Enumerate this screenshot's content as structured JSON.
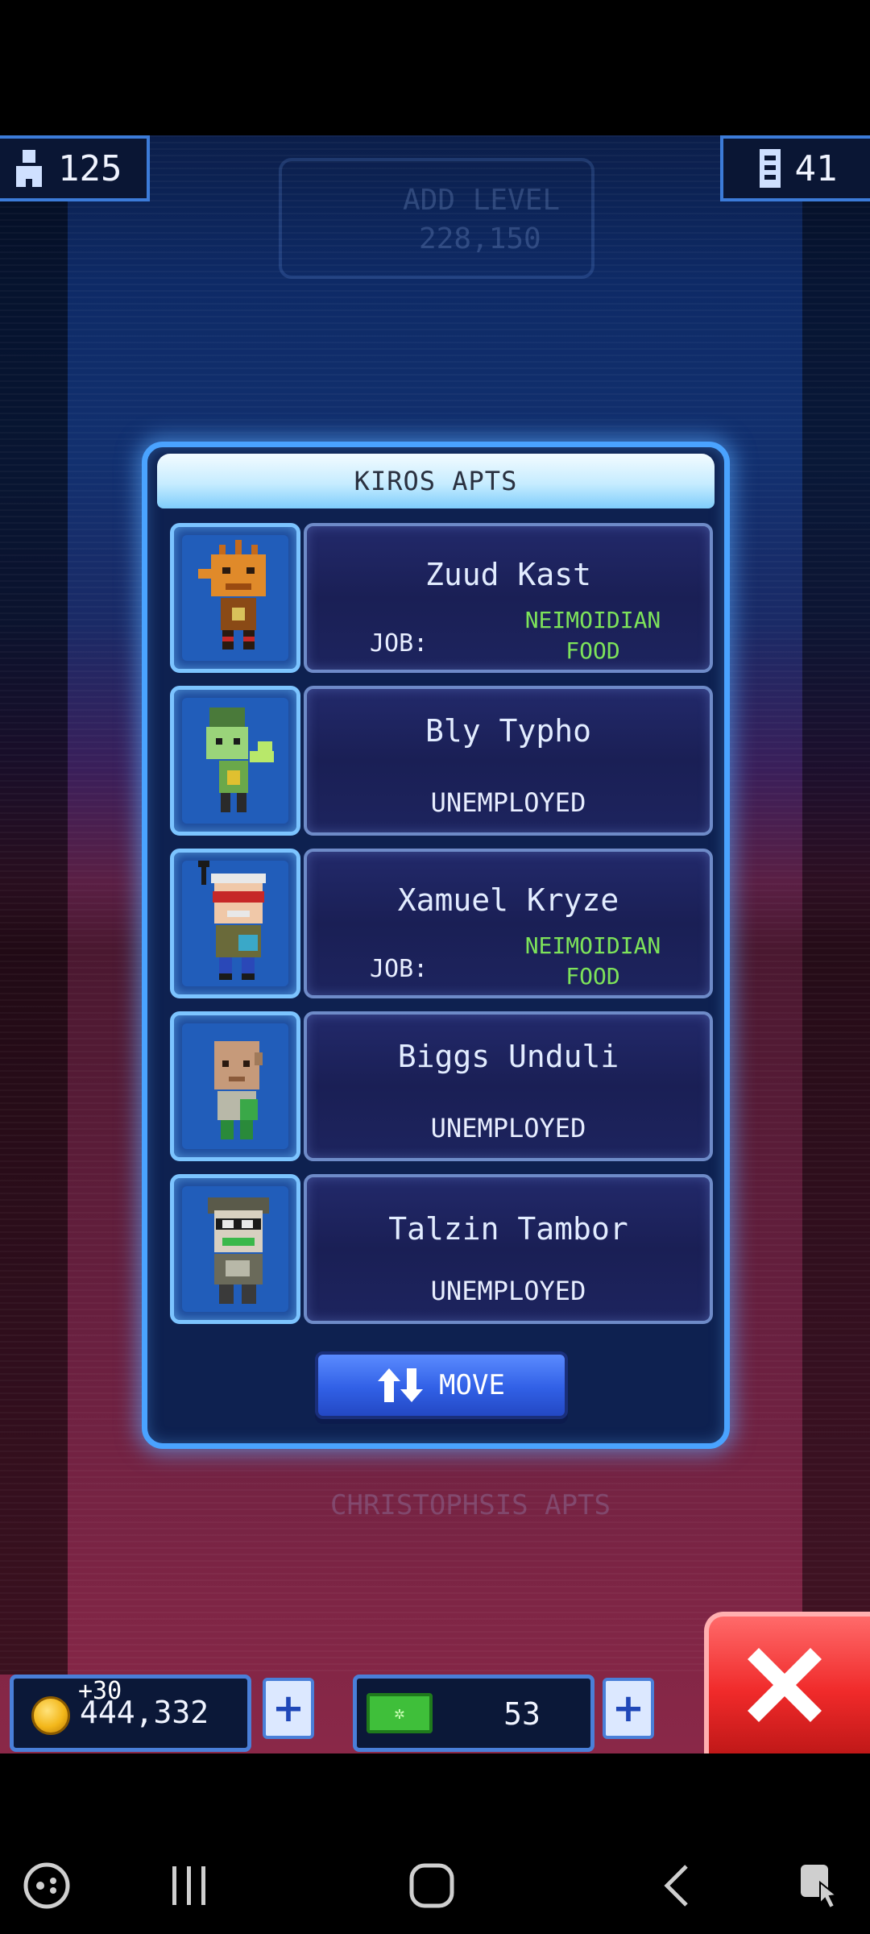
{
  "hud": {
    "population": "125",
    "floors": "41"
  },
  "background": {
    "add_level_label": "ADD LEVEL",
    "add_level_cost": "228,150",
    "floor_label": "CHRISTOPHSIS APTS"
  },
  "modal": {
    "title": "KIROS APTS",
    "residents": [
      {
        "name": "Zuud Kast",
        "job_label": "JOB:",
        "job_line1": "NEIMOIDIAN",
        "job_line2": "FOOD",
        "status": ""
      },
      {
        "name": "Bly Typho",
        "job_label": "",
        "job_line1": "",
        "job_line2": "",
        "status": "UNEMPLOYED"
      },
      {
        "name": "Xamuel Kryze",
        "job_label": "JOB:",
        "job_line1": "NEIMOIDIAN",
        "job_line2": "FOOD",
        "status": ""
      },
      {
        "name": "Biggs Unduli",
        "job_label": "",
        "job_line1": "",
        "job_line2": "",
        "status": "UNEMPLOYED"
      },
      {
        "name": "Talzin Tambor",
        "job_label": "",
        "job_line1": "",
        "job_line2": "",
        "status": "UNEMPLOYED"
      }
    ],
    "move_label": "MOVE"
  },
  "bottom_hud": {
    "coins": "444,332",
    "coin_bonus": "+30",
    "bux": "53"
  },
  "colors": {
    "job_green": "#7de35a",
    "frame_blue": "#4aa3ff",
    "close_red": "#f02a2a"
  }
}
